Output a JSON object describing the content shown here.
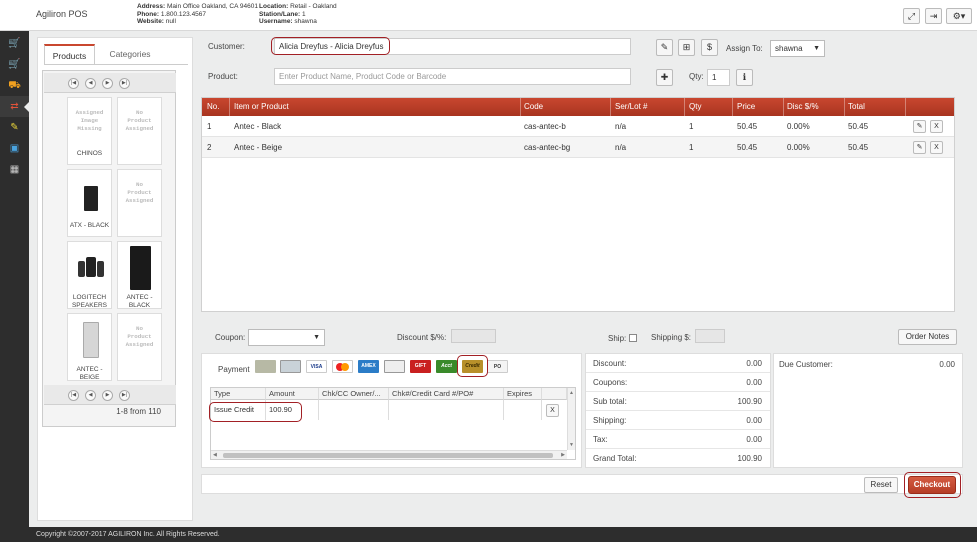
{
  "app": {
    "title": "Agiliron POS",
    "address_label": "Address:",
    "address": "Main Office Oakland, CA 94601",
    "phone_label": "Phone:",
    "phone": "1.800.123.4567",
    "website_label": "Website:",
    "website": "null",
    "location_label": "Location:",
    "location": "Retail - Oakland",
    "station_label": "Station/Lane:",
    "station": "1",
    "username_label": "Username:",
    "username": "shawna"
  },
  "nav": {
    "icons": [
      "cart-icon",
      "cart-icon",
      "cart-outline-icon",
      "transfer-icon",
      "edit-icon",
      "cash-icon",
      "grid-icon"
    ],
    "active_index": 3
  },
  "products_panel": {
    "tabs": [
      "Products",
      "Categories"
    ],
    "items": [
      {
        "placeholder": "Assigned\nImage\nMissing",
        "name": "CHINOS"
      },
      {
        "placeholder": "No\nProduct\nAssigned",
        "name": ""
      },
      {
        "placeholder": "",
        "name": "ATX - BLACK"
      },
      {
        "placeholder": "No\nProduct\nAssigned",
        "name": ""
      },
      {
        "placeholder": "",
        "name": "LOGITECH\nSPEAKERS"
      },
      {
        "placeholder": "",
        "name": "ANTEC -\nBLACK"
      },
      {
        "placeholder": "",
        "name": "ANTEC -\nBEIGE"
      },
      {
        "placeholder": "No\nProduct\nAssigned",
        "name": ""
      }
    ],
    "page_count": "1-8 from 110"
  },
  "customer": {
    "label": "Customer:",
    "value": "Alicia Dreyfus - Alicia Dreyfus",
    "assign_to_label": "Assign To:",
    "assign_to_value": "shawna"
  },
  "product_search": {
    "label": "Product:",
    "placeholder": "Enter Product Name, Product Code or Barcode",
    "qty_label": "Qty:",
    "qty_value": "1"
  },
  "items_table": {
    "headers": [
      "No.",
      "Item or Product",
      "Code",
      "Ser/Lot #",
      "Qty",
      "Price",
      "Disc $/%",
      "Total"
    ],
    "rows": [
      {
        "no": "1",
        "item": "Antec - Black",
        "code": "cas-antec-b",
        "serlot": "n/a",
        "qty": "1",
        "price": "50.45",
        "disc": "0.00%",
        "total": "50.45"
      },
      {
        "no": "2",
        "item": "Antec - Beige",
        "code": "cas-antec-bg",
        "serlot": "n/a",
        "qty": "1",
        "price": "50.45",
        "disc": "0.00%",
        "total": "50.45"
      }
    ],
    "remove_label": "X"
  },
  "order_options": {
    "coupon_label": "Coupon:",
    "discount_label": "Discount $/%:",
    "ship_label": "Ship:",
    "shipping_label": "Shipping $:",
    "order_notes_label": "Order Notes"
  },
  "payment": {
    "label": "Payment",
    "methods": [
      {
        "name": "cash",
        "text": ""
      },
      {
        "name": "check",
        "text": ""
      },
      {
        "name": "visa",
        "text": "VISA"
      },
      {
        "name": "mastercard",
        "text": ""
      },
      {
        "name": "amex",
        "text": "AMEX"
      },
      {
        "name": "card",
        "text": ""
      },
      {
        "name": "gift",
        "text": "GIFT"
      },
      {
        "name": "account",
        "text": "Acct"
      },
      {
        "name": "credit",
        "text": "Credit"
      },
      {
        "name": "po",
        "text": "PO"
      }
    ],
    "headers": [
      "Type",
      "Amount",
      "Chk/CC Owner/...",
      "Chk#/Credit Card #/PO#",
      "Expires"
    ],
    "row": {
      "type": "Issue Credit",
      "amount": "100.90"
    },
    "remove_label": "X"
  },
  "totals": {
    "rows": [
      {
        "label": "Discount:",
        "value": "0.00"
      },
      {
        "label": "Coupons:",
        "value": "0.00"
      },
      {
        "label": "Sub total:",
        "value": "100.90"
      },
      {
        "label": "Shipping:",
        "value": "0.00"
      },
      {
        "label": "Tax:",
        "value": "0.00"
      },
      {
        "label": "Grand Total:",
        "value": "100.90"
      }
    ]
  },
  "due": {
    "label": "Due Customer:",
    "value": "0.00"
  },
  "actions": {
    "reset": "Reset",
    "checkout": "Checkout"
  },
  "footer": {
    "copyright": "Copyright ©2007-2017 AGILIRON Inc. All Rights Reserved."
  }
}
